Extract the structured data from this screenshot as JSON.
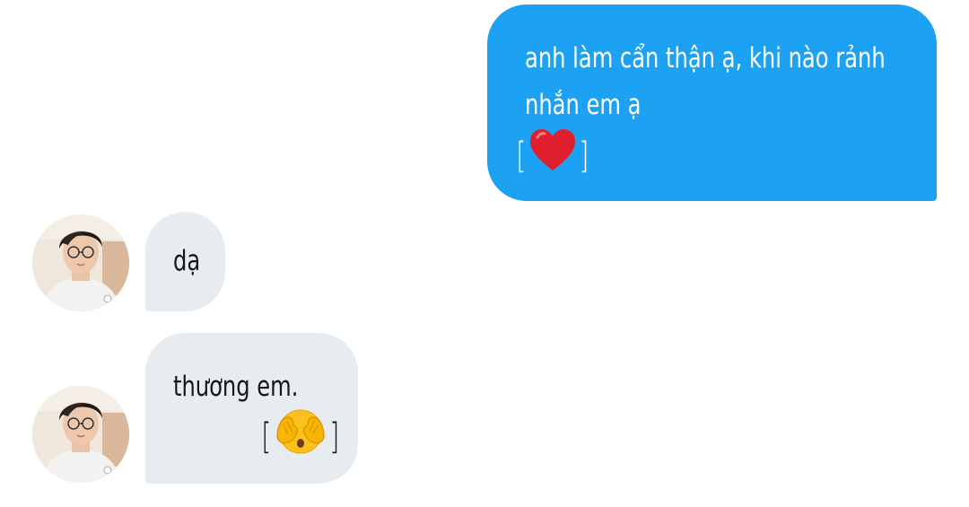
{
  "conversation": {
    "sent_message": {
      "line1": "anh làm cẩn thận ạ, khi nào rảnh",
      "line2": "nhắn em ạ",
      "emoji": "heart-emoji"
    },
    "received_messages": [
      {
        "text": "dạ"
      },
      {
        "text": "thương em.",
        "emoji": "face-with-hand-over-eyes-emoji"
      }
    ],
    "bracket_open": "[",
    "bracket_close": "]"
  },
  "colors": {
    "sent_bubble": "#1da1f2",
    "received_bubble": "#e6ecf0",
    "sent_text": "#ffffff",
    "received_text": "#14171a"
  },
  "icons": {
    "avatar": "user-avatar-photo",
    "heart": "red-heart-icon",
    "hands_face": "face-covering-eyes-icon"
  }
}
